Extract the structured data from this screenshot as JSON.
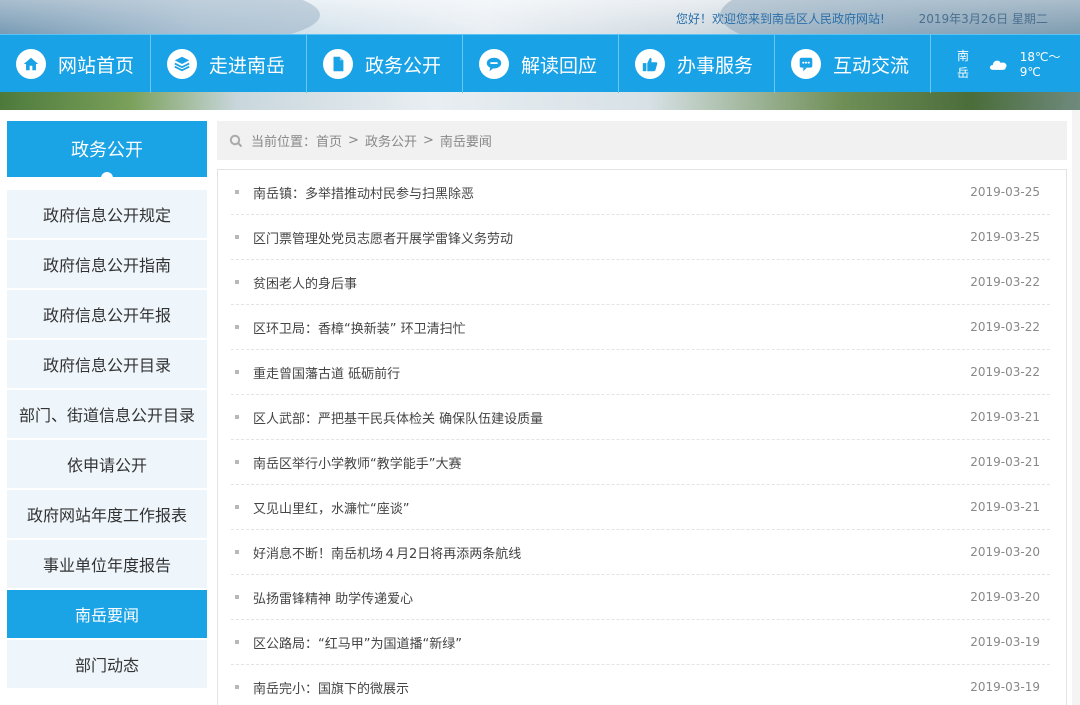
{
  "header": {
    "welcome": "您好！欢迎您来到南岳区人民政府网站!",
    "date": "2019年3月26日  星期二"
  },
  "nav": {
    "items": [
      {
        "label": "网站首页",
        "icon": "home-icon"
      },
      {
        "label": "走进南岳",
        "icon": "layers-icon"
      },
      {
        "label": "政务公开",
        "icon": "document-icon"
      },
      {
        "label": "解读回应",
        "icon": "speech-bubble-icon"
      },
      {
        "label": "办事服务",
        "icon": "thumbs-up-icon"
      },
      {
        "label": "互动交流",
        "icon": "chat-icon"
      }
    ],
    "weather": {
      "city": "南岳",
      "icon": "cloud-icon",
      "temp": "18℃～9℃"
    }
  },
  "sidebar": {
    "title": "政务公开",
    "items": [
      {
        "label": "政府信息公开规定",
        "active": false
      },
      {
        "label": "政府信息公开指南",
        "active": false
      },
      {
        "label": "政府信息公开年报",
        "active": false
      },
      {
        "label": "政府信息公开目录",
        "active": false
      },
      {
        "label": "部门、街道信息公开目录",
        "active": false
      },
      {
        "label": "依申请公开",
        "active": false
      },
      {
        "label": "政府网站年度工作报表",
        "active": false
      },
      {
        "label": "事业单位年度报告",
        "active": false
      },
      {
        "label": "南岳要闻",
        "active": true
      },
      {
        "label": "部门动态",
        "active": false
      }
    ]
  },
  "breadcrumb": {
    "prefix": "当前位置：",
    "items": [
      "首页",
      "政务公开",
      "南岳要闻"
    ],
    "separator": ">"
  },
  "news": [
    {
      "title": "南岳镇：多举措推动村民参与扫黑除恶",
      "date": "2019-03-25"
    },
    {
      "title": "区门票管理处党员志愿者开展学雷锋义务劳动",
      "date": "2019-03-25"
    },
    {
      "title": "贫困老人的身后事",
      "date": "2019-03-22"
    },
    {
      "title": "区环卫局：香樟“换新装” 环卫清扫忙",
      "date": "2019-03-22"
    },
    {
      "title": "重走曾国藩古道 砥砺前行",
      "date": "2019-03-22"
    },
    {
      "title": "区人武部：严把基干民兵体检关 确保队伍建设质量",
      "date": "2019-03-21"
    },
    {
      "title": "南岳区举行小学教师“教学能手”大赛",
      "date": "2019-03-21"
    },
    {
      "title": "又见山里红，水濂忙“座谈”",
      "date": "2019-03-21"
    },
    {
      "title": "好消息不断！南岳机场４月2日将再添两条航线",
      "date": "2019-03-20"
    },
    {
      "title": "弘扬雷锋精神 助学传递爱心",
      "date": "2019-03-20"
    },
    {
      "title": "区公路局：“红马甲”为国道播“新绿”",
      "date": "2019-03-19"
    },
    {
      "title": "南岳完小：国旗下的微展示",
      "date": "2019-03-19"
    }
  ],
  "colors": {
    "accent": "#19a2e6",
    "sidebar_bg": "#eef6fc"
  }
}
